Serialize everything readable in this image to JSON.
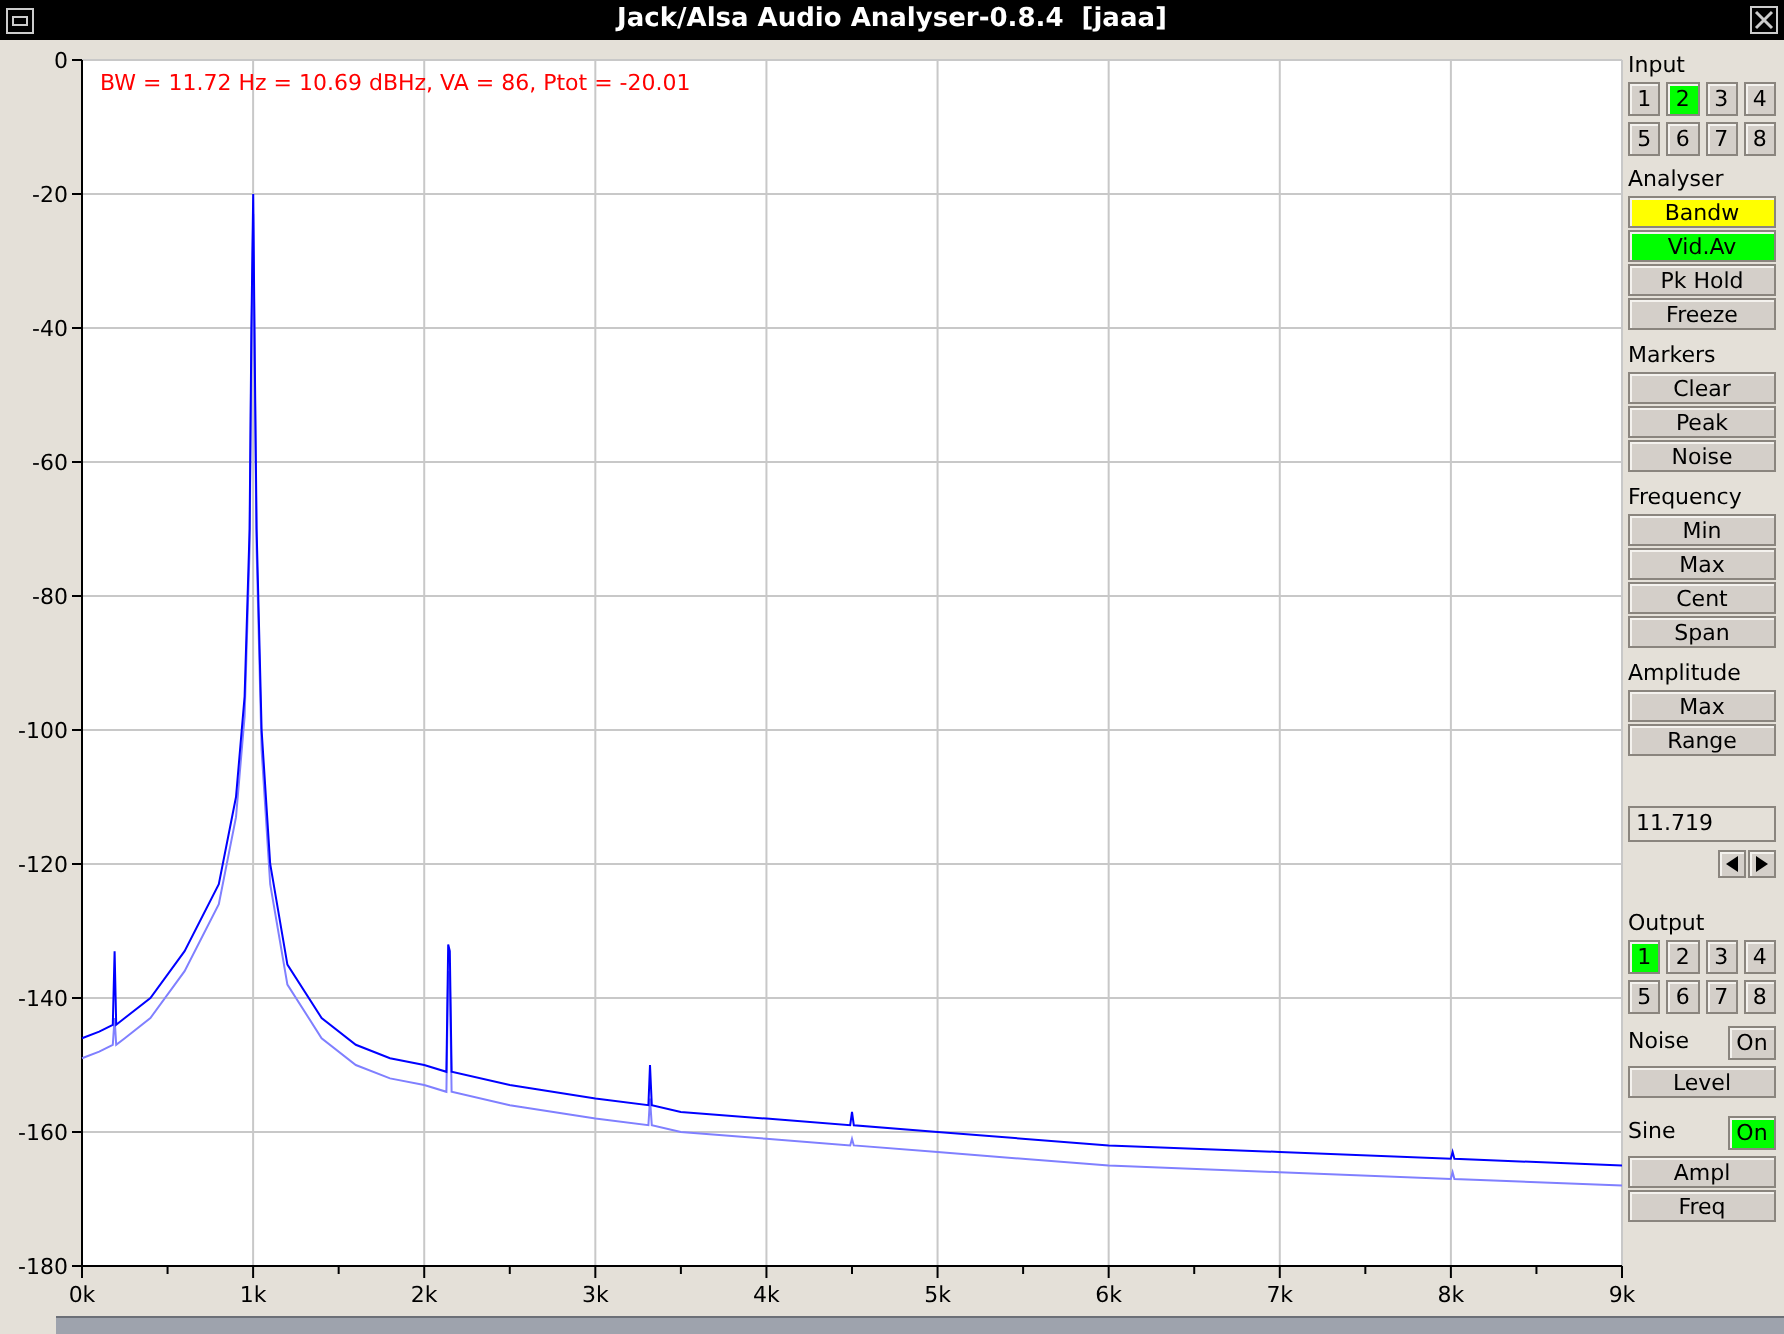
{
  "window": {
    "title": "Jack/Alsa Audio Analyser-0.8.4  [jaaa]"
  },
  "chart": {
    "readout": "BW = 11.72 Hz = 10.69 dBHz, VA = 86, Ptot = -20.01",
    "chart_data": {
      "type": "line",
      "grid": true,
      "xlim": [
        0,
        9
      ],
      "ylim": [
        -180,
        0
      ],
      "xticks": [
        {
          "value": 0,
          "label": "0k"
        },
        {
          "value": 1,
          "label": "1k"
        },
        {
          "value": 2,
          "label": "2k"
        },
        {
          "value": 3,
          "label": "3k"
        },
        {
          "value": 4,
          "label": "4k"
        },
        {
          "value": 5,
          "label": "5k"
        },
        {
          "value": 6,
          "label": "6k"
        },
        {
          "value": 7,
          "label": "7k"
        },
        {
          "value": 8,
          "label": "8k"
        },
        {
          "value": 9,
          "label": "9k"
        }
      ],
      "yticks": [
        0,
        -20,
        -40,
        -60,
        -80,
        -100,
        -120,
        -140,
        -160,
        -180
      ],
      "x": [
        0,
        0.1,
        0.18,
        0.19,
        0.2,
        0.25,
        0.4,
        0.6,
        0.8,
        0.9,
        0.95,
        0.98,
        0.99,
        1.0,
        1.01,
        1.02,
        1.05,
        1.1,
        1.2,
        1.4,
        1.6,
        1.8,
        2.0,
        2.13,
        2.14,
        2.15,
        2.16,
        2.5,
        3.0,
        3.31,
        3.32,
        3.33,
        3.5,
        4.0,
        4.49,
        4.5,
        4.51,
        5,
        6,
        7,
        8,
        8.01,
        8.02,
        9
      ],
      "series": [
        {
          "color": "#0000ff",
          "values": [
            -146,
            -145,
            -144,
            -133,
            -144,
            -143,
            -140,
            -133,
            -123,
            -110,
            -95,
            -70,
            -40,
            -20,
            -45,
            -70,
            -100,
            -120,
            -135,
            -143,
            -147,
            -149,
            -150,
            -151,
            -132,
            -133,
            -151,
            -153,
            -155,
            -156,
            -150,
            -156,
            -157,
            -158,
            -159,
            -157,
            -159,
            -160,
            -162,
            -163,
            -164,
            -163,
            -164,
            -165
          ]
        },
        {
          "color": "#8080ff",
          "values": [
            -149,
            -148,
            -147,
            -143,
            -147,
            -146,
            -143,
            -136,
            -126,
            -113,
            -98,
            -73,
            -43,
            -23,
            -48,
            -73,
            -103,
            -123,
            -138,
            -146,
            -150,
            -152,
            -153,
            -154,
            -136,
            -137,
            -154,
            -156,
            -158,
            -159,
            -155,
            -159,
            -160,
            -161,
            -162,
            -161,
            -162,
            -163,
            -165,
            -166,
            -167,
            -166,
            -167,
            -168
          ]
        }
      ]
    }
  },
  "panel": {
    "input": {
      "label": "Input",
      "channels": [
        {
          "label": "1",
          "selected": false
        },
        {
          "label": "2",
          "selected": true
        },
        {
          "label": "3",
          "selected": false
        },
        {
          "label": "4",
          "selected": false
        },
        {
          "label": "5",
          "selected": false
        },
        {
          "label": "6",
          "selected": false
        },
        {
          "label": "7",
          "selected": false
        },
        {
          "label": "8",
          "selected": false
        }
      ]
    },
    "groups": [
      {
        "label": "Analyser",
        "buttons": [
          {
            "label": "Bandw",
            "color": "#ffff00"
          },
          {
            "label": "Vid.Av",
            "color": "#00ff00"
          },
          {
            "label": "Pk Hold",
            "color": "#d4cfc9"
          },
          {
            "label": "Freeze",
            "color": "#d4cfc9"
          }
        ]
      },
      {
        "label": "Markers",
        "buttons": [
          {
            "label": "Clear",
            "color": "#d4cfc9"
          },
          {
            "label": "Peak",
            "color": "#d4cfc9"
          },
          {
            "label": "Noise",
            "color": "#d4cfc9"
          }
        ]
      },
      {
        "label": "Frequency",
        "buttons": [
          {
            "label": "Min",
            "color": "#d4cfc9"
          },
          {
            "label": "Max",
            "color": "#d4cfc9"
          },
          {
            "label": "Cent",
            "color": "#d4cfc9"
          },
          {
            "label": "Span",
            "color": "#d4cfc9"
          }
        ]
      },
      {
        "label": "Amplitude",
        "buttons": [
          {
            "label": "Max",
            "color": "#d4cfc9"
          },
          {
            "label": "Range",
            "color": "#d4cfc9"
          }
        ]
      }
    ],
    "value": "11.719",
    "output": {
      "label": "Output",
      "channels": [
        {
          "label": "1",
          "selected": true
        },
        {
          "label": "2",
          "selected": false
        },
        {
          "label": "3",
          "selected": false
        },
        {
          "label": "4",
          "selected": false
        },
        {
          "label": "5",
          "selected": false
        },
        {
          "label": "6",
          "selected": false
        },
        {
          "label": "7",
          "selected": false
        },
        {
          "label": "8",
          "selected": false
        }
      ]
    },
    "noise": {
      "label": "Noise",
      "toggle": "On",
      "on": false,
      "buttons": [
        "Level"
      ]
    },
    "sine": {
      "label": "Sine",
      "toggle": "On",
      "on": true,
      "buttons": [
        "Ampl",
        "Freq"
      ]
    }
  }
}
